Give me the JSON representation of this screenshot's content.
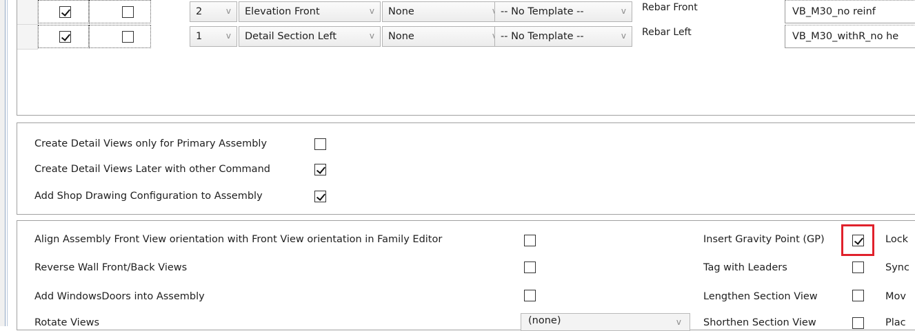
{
  "grid": {
    "rows": [
      {
        "checked_a": true,
        "checked_b": false,
        "number": "2",
        "view": "Elevation Front",
        "option": "None",
        "template": "-- No Template --",
        "name": "Rebar Front",
        "value": "VB_M30_no reinf"
      },
      {
        "checked_a": true,
        "checked_b": false,
        "number": "1",
        "view": "Detail Section Left",
        "option": "None",
        "template": "-- No Template --",
        "name": "Rebar Left",
        "value": "VB_M30_withR_no he"
      }
    ],
    "arrow": "v"
  },
  "detail_options": {
    "primary_only": {
      "label": "Create Detail Views only for Primary Assembly",
      "checked": false
    },
    "later_command": {
      "label": "Create Detail Views Later with other Command",
      "checked": true
    },
    "shop_drawing": {
      "label": "Add Shop Drawing Configuration to Assembly",
      "checked": true
    }
  },
  "assembly_options": {
    "align_front": {
      "label": "Align Assembly Front View orientation with Front View orientation in Family Editor",
      "checked": false
    },
    "reverse_wall": {
      "label": "Reverse Wall Front/Back Views",
      "checked": false
    },
    "windows_doors": {
      "label": "Add WindowsDoors into Assembly",
      "checked": false
    },
    "rotate_views": {
      "label": "Rotate Views",
      "select_value": "(none)"
    }
  },
  "right_options": {
    "gravity_point": {
      "label": "Insert Gravity Point (GP)",
      "checked": true
    },
    "tag_leaders": {
      "label": "Tag with Leaders",
      "checked": false
    },
    "lengthen_section": {
      "label": "Lengthen Section View",
      "checked": false
    },
    "shorthen_section": {
      "label": "Shorthen Section View",
      "checked": false
    }
  },
  "far_right": {
    "lock": "Lock",
    "sync": "Sync",
    "move": "Mov",
    "place": "Plac"
  },
  "colors": {
    "highlight": "#e0212b"
  }
}
